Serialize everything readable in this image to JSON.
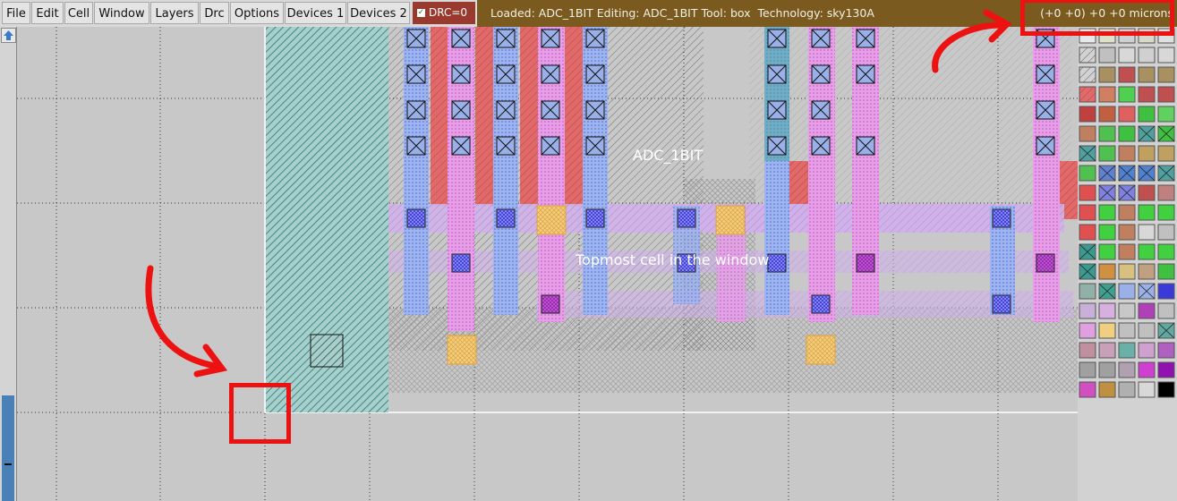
{
  "menu": {
    "file": "File",
    "edit": "Edit",
    "cell": "Cell",
    "window": "Window",
    "layers": "Layers",
    "drc": "Drc",
    "options": "Options",
    "devices1": "Devices 1",
    "devices2": "Devices 2"
  },
  "drc_indicator": "DRC=0",
  "status": {
    "info": "Loaded: ADC_1BIT Editing: ADC_1BIT Tool: box  Technology: sky130A",
    "coordinates": "(+0 +0) +0 +0 microns"
  },
  "canvas": {
    "cell_label": "ADC_1BIT",
    "topmost_label": "Topmost cell in the window"
  },
  "colors": {
    "status_bg": "#7a5a1e",
    "drc_bg": "#9a3a2e",
    "annotation": "#ee1111"
  }
}
